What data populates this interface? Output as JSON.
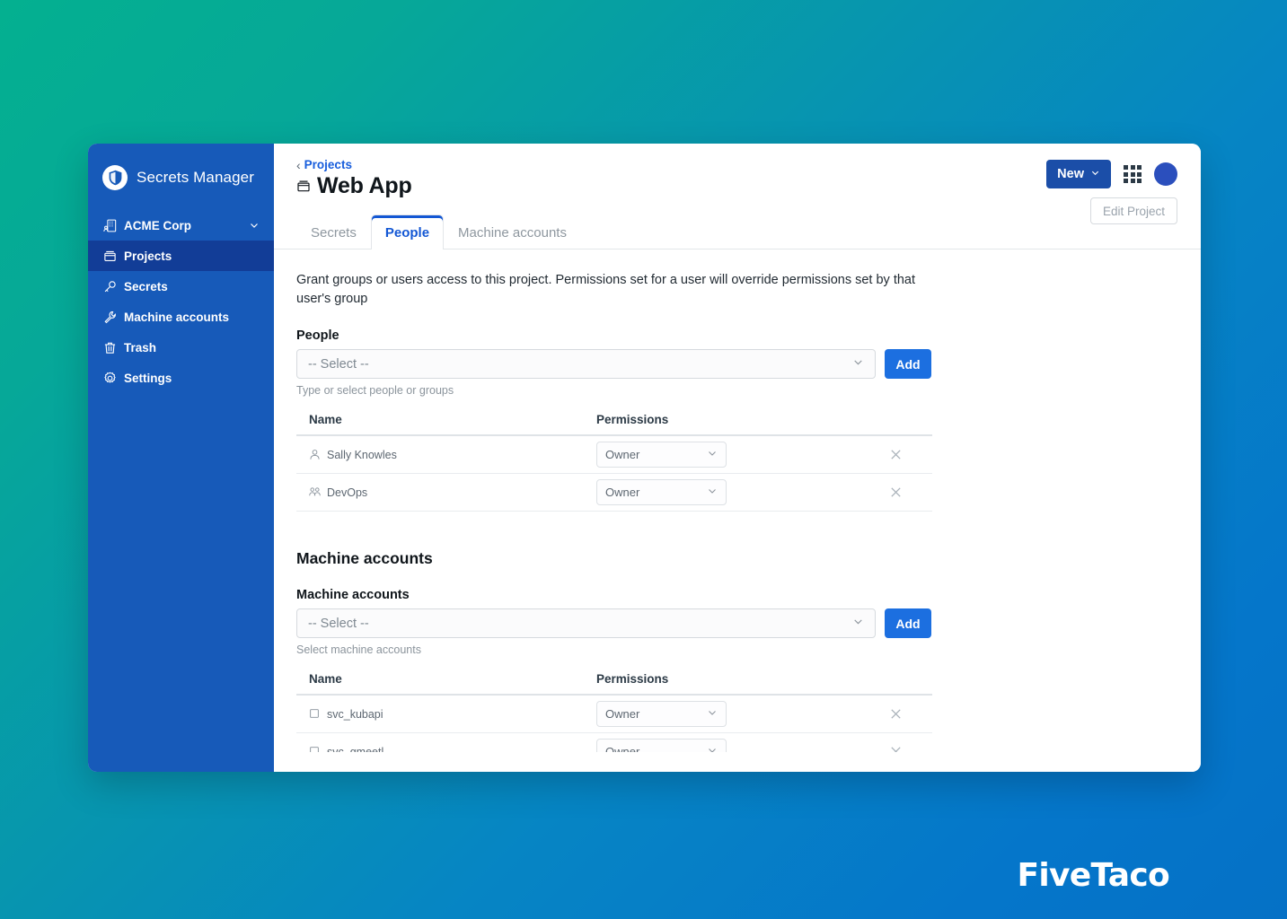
{
  "sidebar": {
    "brand": {
      "name": "Secrets Manager",
      "icon": "shield-icon"
    },
    "org": {
      "label": "ACME Corp",
      "icon": "organization-icon",
      "chevron": "chevron-down-icon"
    },
    "items": [
      {
        "label": "Projects",
        "icon": "collection-icon",
        "active": true
      },
      {
        "label": "Secrets",
        "icon": "key-icon",
        "active": false
      },
      {
        "label": "Machine accounts",
        "icon": "wrench-icon",
        "active": false
      },
      {
        "label": "Trash",
        "icon": "trash-icon",
        "active": false
      },
      {
        "label": "Settings",
        "icon": "gear-icon",
        "active": false
      }
    ]
  },
  "header": {
    "breadcrumb": {
      "chevron": "‹",
      "label": "Projects"
    },
    "title": "Web App",
    "title_icon": "collection-icon",
    "new_button": {
      "label": "New",
      "chevron": "chevron-down-icon"
    },
    "apps_icon": "grid-apps-icon",
    "avatar": "user-avatar",
    "edit_project_button": "Edit Project"
  },
  "tabs": [
    {
      "label": "Secrets",
      "active": false
    },
    {
      "label": "People",
      "active": true
    },
    {
      "label": "Machine accounts",
      "active": false
    }
  ],
  "people_section": {
    "intro": "Grant groups or users access to this project. Permissions set for a user will override permissions set by that user's group",
    "field_label": "People",
    "select_placeholder": "-- Select --",
    "add_label": "Add",
    "hint": "Type or select people or groups",
    "columns": {
      "name": "Name",
      "permissions": "Permissions"
    },
    "rows": [
      {
        "name": "Sally Knowles",
        "icon": "user-icon",
        "permission": "Owner"
      },
      {
        "name": "DevOps",
        "icon": "group-icon",
        "permission": "Owner"
      }
    ]
  },
  "machine_section": {
    "title": "Machine accounts",
    "field_label": "Machine accounts",
    "select_placeholder": "-- Select --",
    "add_label": "Add",
    "hint": "Select machine accounts",
    "columns": {
      "name": "Name",
      "permissions": "Permissions"
    },
    "rows": [
      {
        "name": "svc_kubapi",
        "icon": "machine-account-icon",
        "permission": "Owner"
      },
      {
        "name": "svc_gmeetl",
        "icon": "machine-account-icon",
        "permission": "Owner"
      }
    ]
  },
  "watermark": "FiveTaco",
  "colors": {
    "sidebar_bg": "#175ab9",
    "sidebar_active": "#123d97",
    "primary_blue": "#1c6fe0",
    "new_button": "#1b4ea8",
    "link_blue": "#175ddc",
    "tab_active": "#1357d4",
    "bg_gradient_start": "#04b090",
    "bg_gradient_end": "#0571c6"
  }
}
